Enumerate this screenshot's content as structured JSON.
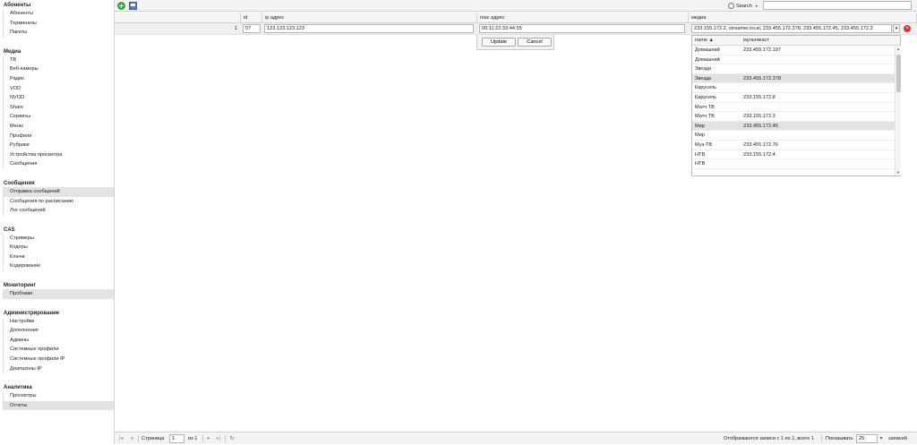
{
  "sidebar": {
    "groups": [
      {
        "title": "Абоненты",
        "items": [
          "Абоненты",
          "Терминалы",
          "Пакеты"
        ]
      },
      {
        "title": "Медиа",
        "items": [
          "ТВ",
          "Веб-камеры",
          "Радио",
          "VOD",
          "NVOD",
          "Share",
          "Сервисы",
          "Меню",
          "Профили",
          "Рубрики",
          "Устройства просмотра",
          "Сообщения"
        ]
      },
      {
        "title": "Сообщения",
        "items": [
          "Отправка сообщений",
          "Сообщения по расписанию",
          "Лог сообщений"
        ]
      },
      {
        "title": "CAS",
        "items": [
          "Стримеры",
          "Кодеры",
          "Ключи",
          "Кодирование"
        ]
      },
      {
        "title": "Мониторинг",
        "items": [
          "Пробники"
        ]
      },
      {
        "title": "Администрирование",
        "items": [
          "Настройки",
          "Дополнения",
          "Админы",
          "Системные профили",
          "Системные профили IP",
          "Диапазоны IP"
        ]
      },
      {
        "title": "Аналитика",
        "items": [
          "Просмотры",
          "Отчеты"
        ]
      }
    ],
    "selected": [
      "Отправка сообщений",
      "Пробники",
      "Отчеты"
    ]
  },
  "toolbar": {
    "add_icon": "add-icon",
    "save_icon": "save-icon",
    "search_label": "Search",
    "search_value": ""
  },
  "grid": {
    "columns": [
      "id",
      "ip адрес",
      "mac адрес",
      "медиа"
    ],
    "edit_row": {
      "row_number": "1",
      "id": "57",
      "ip": "123.123.123.123",
      "mac": "00:11:22:33:44:55",
      "media": "233.155.172.2, streamer.local, 233.455.172.378, 233.455.172.45, 233.455.172.3"
    },
    "update_label": "Update",
    "cancel_label": "Cancel"
  },
  "dropdown": {
    "col_name": "name ▲",
    "col_multicast": "мультикаст",
    "rows": [
      {
        "name": "Домашний",
        "mc": "233.455.172.197",
        "selected": false
      },
      {
        "name": "Домашний",
        "mc": "",
        "selected": false
      },
      {
        "name": "Звезда",
        "mc": "",
        "selected": false
      },
      {
        "name": "Звезда",
        "mc": "233.455.172.378",
        "selected": true
      },
      {
        "name": "Карусель",
        "mc": "",
        "selected": false
      },
      {
        "name": "Карусель",
        "mc": "233.155.172.8",
        "selected": false
      },
      {
        "name": "Матч ТВ",
        "mc": "",
        "selected": false
      },
      {
        "name": "Матч ТВ",
        "mc": "233.155.172.3",
        "selected": false
      },
      {
        "name": "Мир",
        "mc": "233.455.172.45",
        "selected": true
      },
      {
        "name": "Мир",
        "mc": "",
        "selected": false
      },
      {
        "name": "Муз-ТВ",
        "mc": "233.455.172.76",
        "selected": false
      },
      {
        "name": "НТВ",
        "mc": "233.155.172.4",
        "selected": false
      },
      {
        "name": "НТВ",
        "mc": "",
        "selected": false
      }
    ]
  },
  "pager": {
    "page_label": "Страница",
    "page_value": "1",
    "of_label": "из 1",
    "summary": "Отображаются записи с 1 по 1, всего 1",
    "show_label": "Показывать",
    "page_size": "25",
    "records_label": "записей"
  }
}
